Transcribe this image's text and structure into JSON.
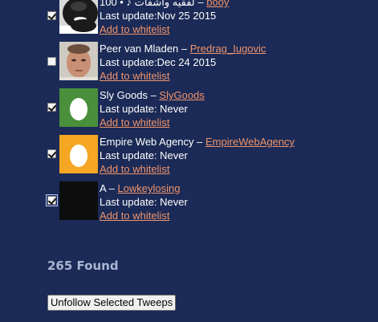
{
  "users": [
    {
      "name": "100 • ♪ لفقيه وأشفات",
      "name_link": "",
      "handle": "booy",
      "separator": " – ",
      "last_update": "Last update:Nov 25 2015",
      "whitelist_label": "Add to whitelist",
      "checked": true,
      "avatar": "photo-dark-beard"
    },
    {
      "name": "Peer van Mladen",
      "handle": "Predrag_Iugovic",
      "separator": " – ",
      "last_update": "Last update:Dec 24 2015",
      "whitelist_label": "Add to whitelist",
      "checked": false,
      "avatar": "photo-man-face"
    },
    {
      "name": "Sly Goods",
      "handle": "SlyGoods",
      "separator": " – ",
      "last_update": "Last update: Never",
      "whitelist_label": "Add to whitelist",
      "checked": true,
      "avatar": "egg-green",
      "avatar_bg": "#4a8f3c"
    },
    {
      "name": "Empire Web Agency",
      "handle": "EmpireWebAgency",
      "separator": " – ",
      "last_update": "Last update: Never",
      "whitelist_label": "Add to whitelist",
      "checked": true,
      "avatar": "egg-orange",
      "avatar_bg": "#f5a623"
    },
    {
      "name": "A",
      "handle": "Lowkeylosing",
      "separator": " – ",
      "last_update": "Last update: Never",
      "whitelist_label": "Add to whitelist",
      "checked": true,
      "avatar": "black-square",
      "avatar_bg": "#0d0d0d"
    }
  ],
  "found_count_text": "265 Found",
  "unfollow_button_label": "Unfollow Selected Tweeps",
  "colors": {
    "background": "#1b2a56",
    "link": "#f0946a",
    "found_text": "#aab7d4"
  }
}
